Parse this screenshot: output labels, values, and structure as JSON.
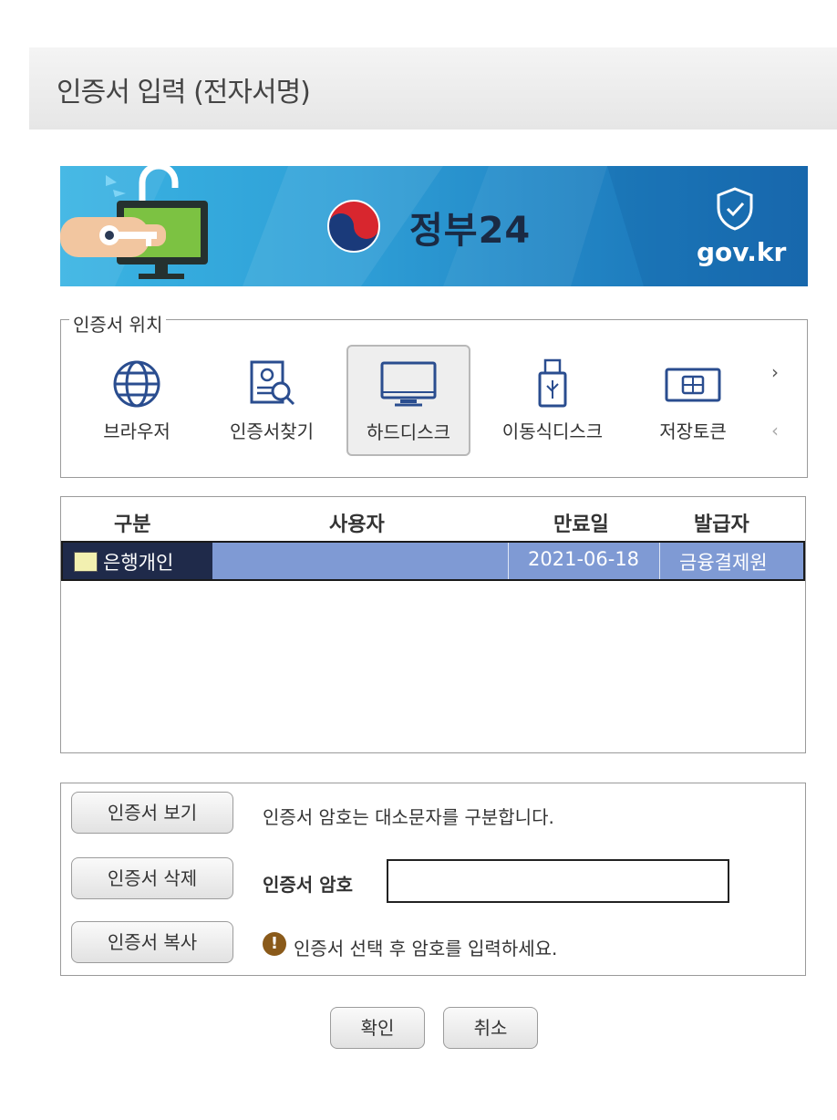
{
  "window": {
    "title": "인증서 입력 (전자서명)"
  },
  "banner": {
    "brand_text": "정부24",
    "domain_text": "gov.kr"
  },
  "location": {
    "legend": "인증서 위치",
    "items": [
      {
        "label": "브라우저",
        "icon": "globe-icon",
        "selected": false
      },
      {
        "label": "인증서찾기",
        "icon": "certificate-search-icon",
        "selected": false
      },
      {
        "label": "하드디스크",
        "icon": "monitor-icon",
        "selected": true
      },
      {
        "label": "이동식디스크",
        "icon": "usb-drive-icon",
        "selected": false
      },
      {
        "label": "저장토큰",
        "icon": "security-token-icon",
        "selected": false
      }
    ],
    "next_arrow": "›",
    "prev_arrow": "‹"
  },
  "table": {
    "headers": [
      "구분",
      "사용자",
      "만료일",
      "발급자"
    ],
    "rows": [
      {
        "type": "은행개인",
        "user": "",
        "expiry": "2021-06-18",
        "issuer": "금융결제원"
      }
    ]
  },
  "actions": {
    "view": "인증서 보기",
    "delete": "인증서 삭제",
    "copy": "인증서 복사"
  },
  "password": {
    "hint": "인증서 암호는 대소문자를 구분합니다.",
    "label": "인증서 암호",
    "value": "",
    "warning": "인증서 선택 후 암호를 입력하세요."
  },
  "footer": {
    "ok": "확인",
    "cancel": "취소"
  },
  "colors": {
    "selected_row": "#7f9ad4",
    "banner": "#2e9ed6",
    "warning_icon": "#8a5a1a"
  }
}
